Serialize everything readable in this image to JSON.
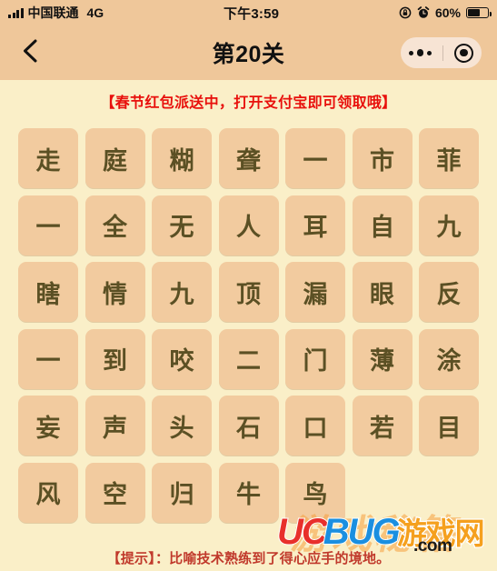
{
  "status_bar": {
    "signal_icon": "signal-bars-icon",
    "carrier": "中国联通",
    "network": "4G",
    "time": "下午3:59",
    "rotation_lock_icon": "rotation-lock-icon",
    "alarm_icon": "alarm-clock-icon",
    "battery_percent": "60%",
    "battery_icon": "battery-icon",
    "battery_level": 60
  },
  "nav_bar": {
    "back_icon": "chevron-left-icon",
    "title": "第20关",
    "capsule": {
      "more_icon": "more-dots-icon",
      "target_icon": "target-circle-icon"
    }
  },
  "banner": {
    "text": "【春节红包派送中，打开支付宝即可领取哦】",
    "color": "#E8100C"
  },
  "grid": {
    "tile_color": "#F2CB9F",
    "text_color": "#5B5024",
    "rows": [
      [
        "走",
        "庭",
        "糊",
        "聋",
        "一",
        "市",
        "菲"
      ],
      [
        "一",
        "全",
        "无",
        "人",
        "耳",
        "自",
        "九"
      ],
      [
        "瞎",
        "情",
        "九",
        "顶",
        "漏",
        "眼",
        "反"
      ],
      [
        "一",
        "到",
        "咬",
        "二",
        "门",
        "薄",
        "涂"
      ],
      [
        "妄",
        "声",
        "头",
        "石",
        "口",
        "若",
        "目"
      ],
      [
        "风",
        "空",
        "归",
        "牛",
        "鸟"
      ]
    ]
  },
  "hint": {
    "text": "【提示】：比喻技术熟练到了得心应手的境地。",
    "color": "#C0392B"
  },
  "watermark": {
    "part_uc": "UC",
    "part_bug": "BUG",
    "part_cn": "游戏网",
    "ghost": "游戏秘籍",
    "domain": ".com"
  },
  "theme": {
    "page_background": "#FAEFC8",
    "bar_background": "#EFC79A",
    "capsule_background": "#F7E4D4"
  }
}
